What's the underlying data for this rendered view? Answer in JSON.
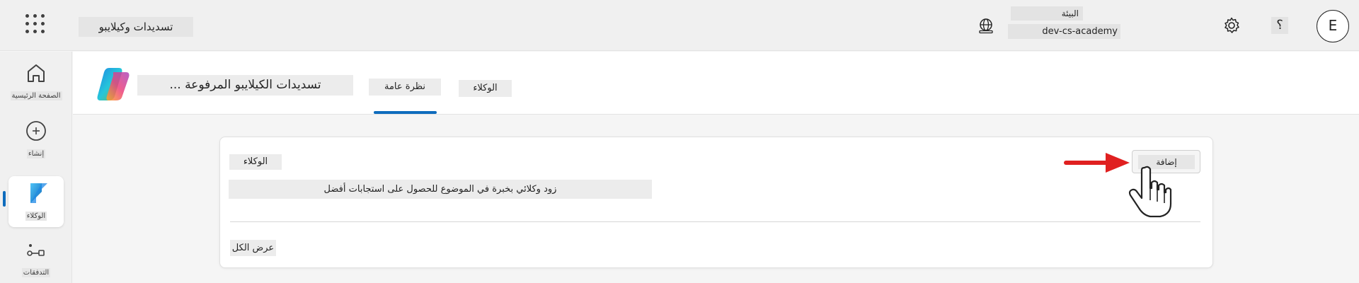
{
  "header": {
    "app_name": "تسديدات وكيلايبو",
    "environment_label": "البيئة",
    "environment_name": "dev-cs-academy",
    "help_label": "؟",
    "avatar_initial": "E",
    "icons": [
      "app-launcher-icon",
      "globe-icon",
      "gear-icon"
    ]
  },
  "rail": {
    "items": [
      {
        "label": "الصفحة الرئيسية",
        "icon": "home-icon"
      },
      {
        "label": "إنشاء",
        "icon": "add-icon"
      },
      {
        "label": "الوكلاء",
        "icon": "agents-icon"
      },
      {
        "label": "التدفقات",
        "icon": "flow-icon"
      }
    ]
  },
  "agent": {
    "title": "... تسديدات الكيلايبو المرفوعة",
    "tabs": [
      {
        "label": "نظرة عامة",
        "selected": true
      },
      {
        "label": "الوكلاء",
        "selected": false
      }
    ]
  },
  "card": {
    "title": "الوكلاء",
    "description": "زود وكلائي بخبرة في الموضوع للحصول على استجابات أفضل",
    "add_label": "إضافة",
    "show_all": "عرض الكل"
  },
  "colors": {
    "accent": "#0f6cbd",
    "annotation": "#e02020"
  }
}
